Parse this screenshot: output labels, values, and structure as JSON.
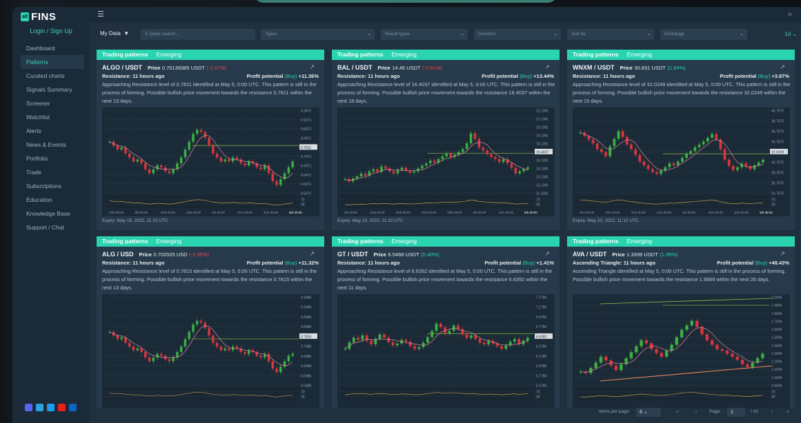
{
  "app": {
    "brand_prefix": "alt",
    "brand_name": "FINS",
    "login_label": "Login / Sign Up",
    "accent": "#2ad4b0"
  },
  "topbar": {
    "menu_icon": "hamburger-icon",
    "right_icon": "settings-icon"
  },
  "sidebar": {
    "items": [
      {
        "label": "Dashboard",
        "active": false
      },
      {
        "label": "Patterns",
        "active": true
      },
      {
        "label": "Curated charts",
        "active": false
      },
      {
        "label": "Signals Summary",
        "active": false
      },
      {
        "label": "Screener",
        "active": false
      },
      {
        "label": "Watchlist",
        "active": false
      },
      {
        "label": "Alerts",
        "active": false
      },
      {
        "label": "News & Events",
        "active": false
      },
      {
        "label": "Portfolio",
        "active": false
      },
      {
        "label": "Trade",
        "active": false
      },
      {
        "label": "Subscriptions",
        "active": false
      },
      {
        "label": "Education",
        "active": false
      },
      {
        "label": "Knowledge Base",
        "active": false
      },
      {
        "label": "Support / Chat",
        "active": false
      }
    ],
    "socials": [
      {
        "name": "discord-icon",
        "color": "#5865f2"
      },
      {
        "name": "telegram-icon",
        "color": "#2aa3e0"
      },
      {
        "name": "twitter-icon",
        "color": "#1d9bf0"
      },
      {
        "name": "youtube-icon",
        "color": "#e62117"
      },
      {
        "name": "linkedin-icon",
        "color": "#0a66c2"
      }
    ]
  },
  "filters": {
    "my_data": "My Data",
    "search_placeholder": "Quick search...",
    "types": "Types",
    "result_types": "Result types",
    "direction": "Direction",
    "sort_by": "Sort by",
    "exchange": "Exchange",
    "timeframe": "1d"
  },
  "cards": [
    {
      "tab1": "Trading patterns",
      "tab2": "Emerging",
      "pair": "ALGO / USDT",
      "price_label": "Price",
      "price": "0.70139385 USDT",
      "change": "(-2.07%)",
      "change_dir": "down",
      "ago": "Resistance: 11 hours ago",
      "profit_label": "Profit potential",
      "profit_dir": "(Buy)",
      "profit": "+11.36%",
      "desc": "Approaching Resistance level of 0.7811 identified at May 5, 0:00 UTC. This pattern is still in the process of forming. Possible bullish price movement towards the resistance 0.7811 within the next 13 days.",
      "expiry": "Expiry: May 18, 2022, 11:10 UTC",
      "y_ticks": [
        "0.9471",
        "0.9171",
        "0.8971",
        "0.8471",
        "0.7811",
        "0.7471",
        "0.6971",
        "0.6471",
        "0.5971",
        "0.5471"
      ],
      "x_ticks": [
        "2/23 00:00",
        "3/5 00:00",
        "3/15 00:00",
        "3/25 00:00",
        "4/4 00:00",
        "4/14 00:00",
        "4/24 00:00",
        "5/5 00:00"
      ],
      "series": [
        0.8,
        0.78,
        0.76,
        0.77,
        0.74,
        0.72,
        0.7,
        0.71,
        0.69,
        0.66,
        0.64,
        0.66,
        0.68,
        0.67,
        0.65,
        0.64,
        0.66,
        0.69,
        0.72,
        0.76,
        0.8,
        0.84,
        0.86,
        0.85,
        0.82,
        0.78,
        0.74,
        0.72,
        0.7,
        0.71,
        0.7,
        0.72,
        0.71,
        0.69,
        0.68,
        0.7,
        0.69,
        0.67,
        0.66,
        0.68,
        0.64,
        0.6,
        0.58,
        0.61,
        0.64,
        0.67,
        0.7
      ],
      "res_level": 0.7811,
      "ymin": 0.54,
      "ymax": 0.96
    },
    {
      "tab1": "Trading patterns",
      "tab2": "Emerging",
      "pair": "BAL / USDT",
      "price_label": "Price",
      "price": "14.46 USDT",
      "change": "(-0.51%)",
      "change_dir": "down",
      "ago": "Resistance: 11 hours ago",
      "profit_label": "Profit potential",
      "profit_dir": "(Buy)",
      "profit": "+13.44%",
      "desc": "Approaching Resistance level of 16.4037 identified at May 5, 0:00 UTC. This pattern is still in the process of forming. Possible bullish price movement towards the resistance 16.4037 within the next 18 days.",
      "expiry": "Expiry: May 23, 2022, 11:10 UTC",
      "y_ticks": [
        "22.1381",
        "21.1381",
        "20.1381",
        "19.1381",
        "18.1381",
        "16.4037",
        "15.1381",
        "14.1381",
        "13.1381",
        "12.1381",
        "11.1381"
      ],
      "x_ticks": [
        "2/2 00:00",
        "2/15 00:00",
        "2/28 00:00",
        "3/13 00:00",
        "3/26 00:00",
        "4/8 00:00",
        "4/21 00:00",
        "5/5 00:00"
      ],
      "series": [
        12.8,
        12.5,
        12.9,
        13.2,
        13.6,
        13.3,
        13.9,
        14.2,
        13.8,
        14.6,
        14.3,
        13.9,
        13.6,
        14.1,
        14.4,
        14.0,
        13.7,
        13.9,
        14.3,
        14.7,
        15.0,
        15.4,
        15.1,
        15.6,
        16.0,
        16.4,
        15.9,
        16.2,
        16.6,
        17.0,
        17.8,
        19.2,
        18.4,
        17.2,
        16.8,
        16.3,
        15.9,
        15.6,
        15.2,
        15.6,
        15.0,
        14.4,
        13.6,
        13.9,
        14.2,
        14.46
      ],
      "res_level": 16.4037,
      "ymin": 10.9,
      "ymax": 22.4
    },
    {
      "tab1": "Trading patterns",
      "tab2": "Emerging",
      "pair": "WNXM / USDT",
      "price_label": "Price",
      "price": "30.831 USDT",
      "change": "(1.84%)",
      "change_dir": "up",
      "ago": "Resistance: 11 hours ago",
      "profit_label": "Profit potential",
      "profit_dir": "(Buy)",
      "profit": "+3.87%",
      "desc": "Approaching Resistance level of 32.0249 identified at May 5, 0:00 UTC. This pattern is still in the process of forming. Possible bullish price movement towards the resistance 32.0249 within the next 15 days.",
      "expiry": "Expiry: May 20, 2022, 11:10 UTC",
      "y_ticks": [
        "40.7575",
        "38.7575",
        "36.7575",
        "34.7575",
        "32.0249",
        "30.7575",
        "28.7575",
        "26.7575",
        "24.7575"
      ],
      "x_ticks": [
        "2/14 00:00",
        "2/27 00:00",
        "3/10 00:00",
        "3/21 00:00",
        "4/1 00:00",
        "4/12 00:00",
        "4/23 00:00",
        "5/5 00:00"
      ],
      "series": [
        36.5,
        35.8,
        35.0,
        34.2,
        33.0,
        32.4,
        31.5,
        33.6,
        35.2,
        36.8,
        35.6,
        34.0,
        33.0,
        31.8,
        30.4,
        29.6,
        28.8,
        28.2,
        27.8,
        28.5,
        29.2,
        30.0,
        29.6,
        30.4,
        31.2,
        32.0,
        32.6,
        33.4,
        34.0,
        34.6,
        35.4,
        36.2,
        35.0,
        33.0,
        30.8,
        29.5,
        28.6,
        29.2,
        30.0,
        29.4,
        28.8,
        29.6,
        30.2,
        30.8
      ],
      "res_level": 32.0249,
      "ymin": 23.8,
      "ymax": 41.2
    },
    {
      "tab1": "Trading patterns",
      "tab2": "Emerging",
      "pair": "ALG / USD",
      "price_label": "Price",
      "price": "0.702025 USD",
      "change": "(-1.95%)",
      "change_dir": "down",
      "ago": "Resistance: 11 hours ago",
      "profit_label": "Profit potential",
      "profit_dir": "(Buy)",
      "profit": "+11.32%",
      "desc": "Approaching Resistance level of 0.7815 identified at May 5, 0:00 UTC. This pattern is still in the process of forming. Possible bullish price movement towards the resistance 0.7815 within the next 13 days.",
      "expiry": "",
      "y_ticks": [
        "0.9986",
        "0.9486",
        "0.8986",
        "0.8486",
        "0.7815",
        "0.7486",
        "0.6986",
        "0.6486",
        "0.5986",
        "0.5486"
      ],
      "x_ticks": [],
      "series": [
        0.82,
        0.8,
        0.78,
        0.79,
        0.76,
        0.74,
        0.72,
        0.73,
        0.71,
        0.68,
        0.66,
        0.68,
        0.7,
        0.69,
        0.67,
        0.66,
        0.68,
        0.71,
        0.74,
        0.78,
        0.82,
        0.86,
        0.88,
        0.87,
        0.84,
        0.8,
        0.76,
        0.74,
        0.72,
        0.73,
        0.72,
        0.74,
        0.73,
        0.71,
        0.7,
        0.72,
        0.71,
        0.69,
        0.68,
        0.7,
        0.66,
        0.62,
        0.6,
        0.63,
        0.66,
        0.69,
        0.7
      ],
      "res_level": 0.7815,
      "ymin": 0.53,
      "ymax": 1.01
    },
    {
      "tab1": "Trading patterns",
      "tab2": "Emerging",
      "pair": "GT / USDT",
      "price_label": "Price",
      "price": "6.5468 USDT",
      "change": "(0.40%)",
      "change_dir": "up",
      "ago": "Resistance: 11 hours ago",
      "profit_label": "Profit potential",
      "profit_dir": "(Buy)",
      "profit": "+1.41%",
      "desc": "Approaching Resistance level of 6.6392 identified at May 5, 0:00 UTC. This pattern is still in the process of forming. Possible bullish price movement towards the resistance 6.6392 within the next 11 days.",
      "expiry": "",
      "y_ticks": [
        "7.3780",
        "7.1780",
        "6.9780",
        "6.7780",
        "6.6392",
        "6.3780",
        "6.1780",
        "5.9780",
        "5.7780",
        "5.5780"
      ],
      "x_ticks": [],
      "series": [
        6.3,
        6.45,
        6.55,
        6.5,
        6.6,
        6.48,
        6.4,
        6.52,
        6.62,
        6.55,
        6.45,
        6.38,
        6.42,
        6.5,
        6.46,
        6.36,
        6.3,
        6.34,
        6.44,
        6.56,
        6.7,
        6.86,
        6.78,
        6.64,
        6.7,
        6.82,
        6.74,
        6.62,
        6.54,
        6.6,
        6.52,
        6.44,
        6.4,
        6.48,
        6.42,
        6.36,
        6.3,
        6.38,
        6.46,
        6.52,
        6.4,
        6.48,
        6.55
      ],
      "res_level": 6.6392,
      "ymin": 5.5,
      "ymax": 7.45
    },
    {
      "tab1": "Trading patterns",
      "tab2": "Emerging",
      "pair": "AVA / USDT",
      "price_label": "Price",
      "price": "1.3399 USDT",
      "change": "(1.95%)",
      "change_dir": "up",
      "ago": "Ascending Triangle: 11 hours ago",
      "profit_label": "Profit potential",
      "profit_dir": "(Buy)",
      "profit": "+48.43%",
      "desc": "Ascending Triangle identified at May 5, 0:00 UTC. This pattern is still in the process of forming. Possible bullish price movement towards the resistance 1.9889 within the next 26 days.",
      "expiry": "",
      "y_ticks": [
        "2.0694",
        "1.9694",
        "1.8694",
        "1.7694",
        "1.6694",
        "1.5694",
        "1.4694",
        "1.3694",
        "1.2694",
        "1.1694",
        "1.0694",
        "0.9694"
      ],
      "x_ticks": [],
      "series": [
        1.1,
        1.08,
        1.15,
        1.22,
        1.3,
        1.25,
        1.18,
        1.12,
        1.2,
        1.28,
        1.36,
        1.44,
        1.52,
        1.48,
        1.4,
        1.35,
        1.3,
        1.38,
        1.46,
        1.56,
        1.66,
        1.72,
        1.78,
        1.7,
        1.6,
        1.52,
        1.46,
        1.4,
        1.38,
        1.34,
        1.3,
        1.26,
        1.2,
        1.16,
        1.22,
        1.28,
        1.34
      ],
      "res_level": 1.9889,
      "ymin": 0.92,
      "ymax": 2.1
    }
  ],
  "pager": {
    "items_per_page_label": "Items per page:",
    "items_per_page": "6",
    "page_label": "Page:",
    "page": "1",
    "total": "/ 42"
  }
}
